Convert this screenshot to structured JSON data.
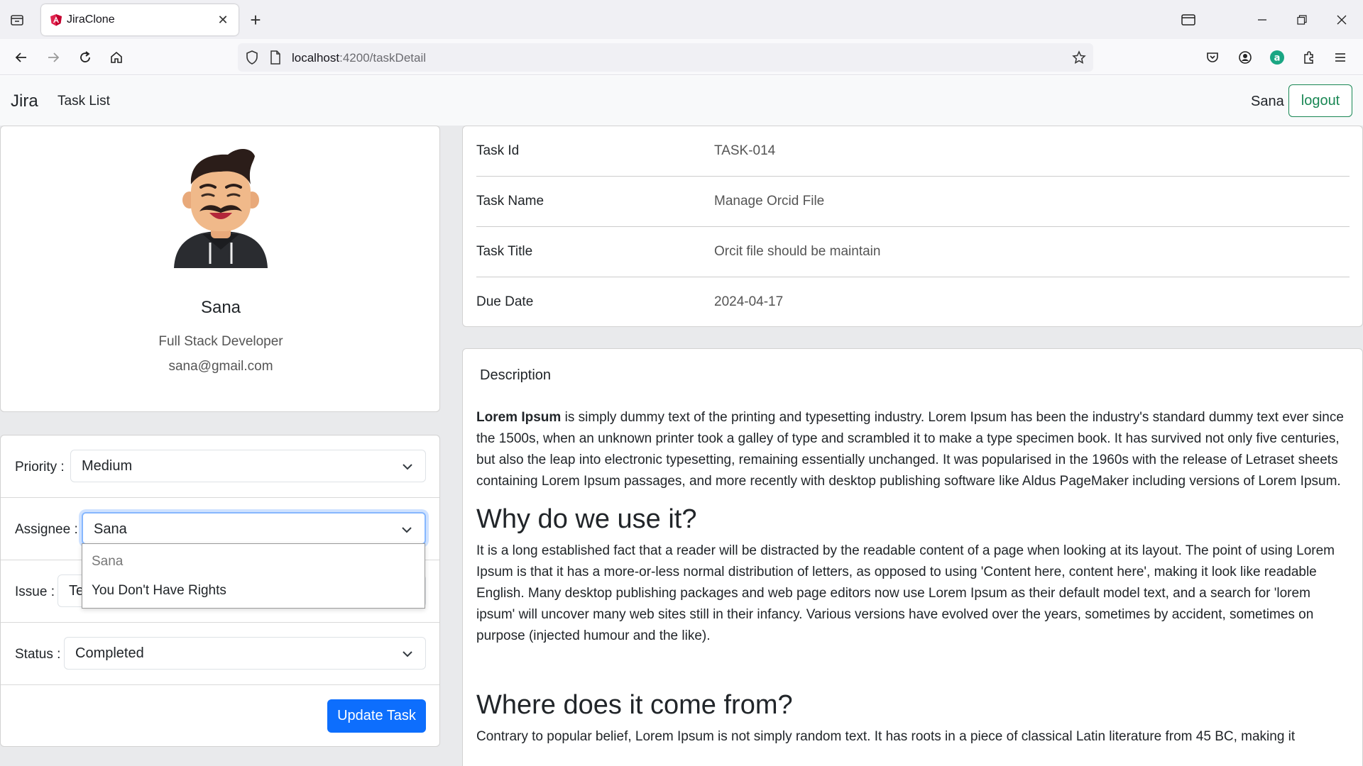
{
  "browser": {
    "tab_title": "JiraClone",
    "url_host": "localhost",
    "url_path": ":4200/taskDetail"
  },
  "app": {
    "brand": "Jira",
    "nav_task_list": "Task List",
    "current_user": "Sana",
    "logout_label": "logout"
  },
  "profile": {
    "name": "Sana",
    "role": "Full Stack Developer",
    "email": "sana@gmail.com"
  },
  "form": {
    "priority_label": "Priority :",
    "priority_value": "Medium",
    "assignee_label": "Assignee :",
    "assignee_value": "Sana",
    "issue_label": "Issue :",
    "issue_value": "Te",
    "status_label": "Status :",
    "status_value": "Completed",
    "update_button": "Update Task",
    "assignee_options": [
      "Sana",
      "You Don't Have Rights"
    ]
  },
  "task": {
    "rows": [
      {
        "label": "Task Id",
        "value": "TASK-014"
      },
      {
        "label": "Task Name",
        "value": "Manage Orcid File"
      },
      {
        "label": "Task Title",
        "value": "Orcit file should be maintain"
      },
      {
        "label": "Due Date",
        "value": "2024-04-17"
      }
    ]
  },
  "description": {
    "heading": "Description",
    "p1_bold": "Lorem Ipsum",
    "p1_rest": " is simply dummy text of the printing and typesetting industry. Lorem Ipsum has been the industry's standard dummy text ever since the 1500s, when an unknown printer took a galley of type and scrambled it to make a type specimen book. It has survived not only five centuries, but also the leap into electronic typesetting, remaining essentially unchanged. It was popularised in the 1960s with the release of Letraset sheets containing Lorem Ipsum passages, and more recently with desktop publishing software like Aldus PageMaker including versions of Lorem Ipsum.",
    "h2_why": "Why do we use it?",
    "p2": "It is a long established fact that a reader will be distracted by the readable content of a page when looking at its layout. The point of using Lorem Ipsum is that it has a more-or-less normal distribution of letters, as opposed to using 'Content here, content here', making it look like readable English. Many desktop publishing packages and web page editors now use Lorem Ipsum as their default model text, and a search for 'lorem ipsum' will uncover many web sites still in their infancy. Various versions have evolved over the years, sometimes by accident, sometimes on purpose (injected humour and the like).",
    "h2_where": "Where does it come from?",
    "p3": "Contrary to popular belief, Lorem Ipsum is not simply random text. It has roots in a piece of classical Latin literature from 45 BC, making it"
  },
  "icons": {
    "tab_list": "tab-list-icon",
    "favicon": "angular-logo-icon",
    "close": "close-icon",
    "new_tab": "plus-icon",
    "back": "arrow-left-icon",
    "forward": "arrow-right-icon",
    "reload": "reload-icon",
    "home": "home-icon",
    "shield": "shield-icon",
    "page": "page-icon",
    "bookmark": "star-icon",
    "pocket": "pocket-icon",
    "account": "account-icon",
    "extension_a": "extension-a-icon",
    "extensions": "puzzle-icon",
    "menu": "hamburger-menu-icon"
  },
  "colors": {
    "primary": "#0d6efd",
    "success": "#198754",
    "focus_ring": "#86b7fe"
  }
}
